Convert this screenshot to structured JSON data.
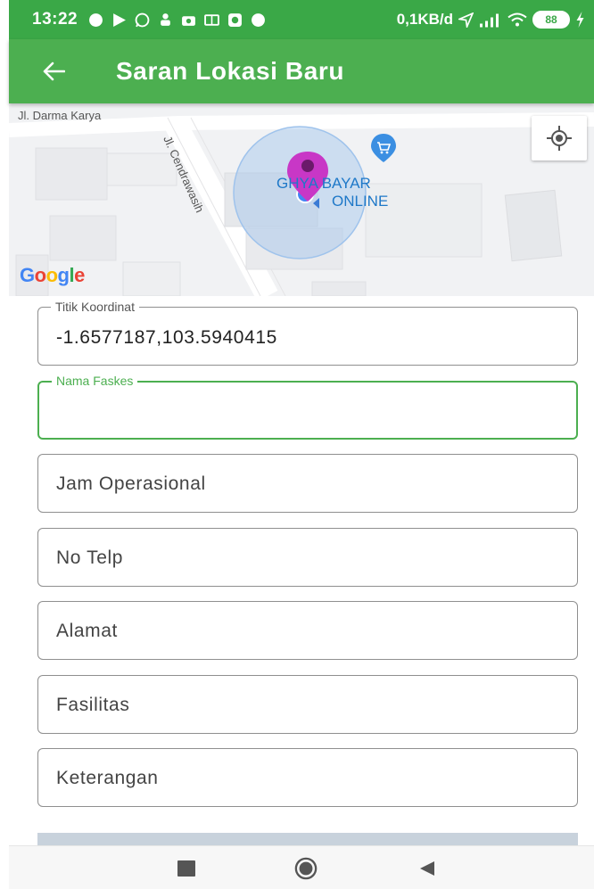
{
  "status_bar": {
    "time": "13:22",
    "network_speed": "0,1KB/d",
    "battery": "88"
  },
  "app_bar": {
    "title": "Saran Lokasi Baru"
  },
  "map": {
    "streets": [
      "Jl. Darma Karya",
      "Jl. Cendrawasih"
    ],
    "poi_line1": "GRIYA BAYAR",
    "poi_line2": "ONLINE",
    "poi_line1_visible": "GHYA BAYAR",
    "attribution": "Google"
  },
  "form": {
    "titik_koordinat": {
      "label": "Titik Koordinat",
      "value": "-1.6577187,103.5940415"
    },
    "nama_faskes": {
      "label": "Nama Faskes",
      "value": ""
    },
    "jam_operasional": {
      "placeholder": "Jam Operasional"
    },
    "no_telp": {
      "placeholder": "No Telp"
    },
    "alamat": {
      "placeholder": "Alamat"
    },
    "fasilitas": {
      "placeholder": "Fasilitas"
    },
    "keterangan": {
      "placeholder": "Keterangan"
    }
  },
  "colors": {
    "primary": "#4caf50",
    "status_bar": "#3aa847",
    "marker": "#c837c6",
    "poi_blue": "#1e78c8"
  }
}
